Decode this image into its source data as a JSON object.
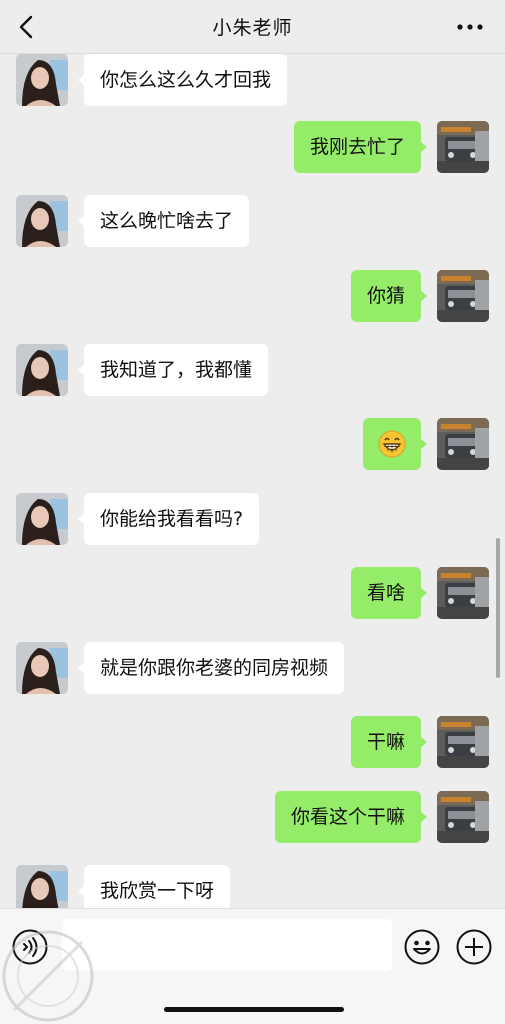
{
  "header": {
    "title": "小朱老师"
  },
  "messages": [
    {
      "side": "left",
      "text": "你怎么这么久才回我"
    },
    {
      "side": "right",
      "text": "我刚去忙了"
    },
    {
      "side": "left",
      "text": "这么晚忙啥去了"
    },
    {
      "side": "right",
      "text": "你猜"
    },
    {
      "side": "left",
      "text": "我知道了，我都懂"
    },
    {
      "side": "right",
      "emoji": "grinning-face-emoji"
    },
    {
      "side": "left",
      "text": "你能给我看看吗?"
    },
    {
      "side": "right",
      "text": "看啥"
    },
    {
      "side": "left",
      "text": "就是你跟你老婆的同房视频"
    },
    {
      "side": "right",
      "text": "干嘛"
    },
    {
      "side": "right",
      "text": "你看这个干嘛"
    },
    {
      "side": "left",
      "text": "我欣赏一下呀"
    }
  ],
  "input_bar": {
    "input_value": "",
    "icons": [
      "voice-icon",
      "emoji-icon",
      "plus-icon"
    ]
  },
  "colors": {
    "background": "#ededed",
    "self_bubble": "#95ec69",
    "other_bubble": "#ffffff"
  }
}
